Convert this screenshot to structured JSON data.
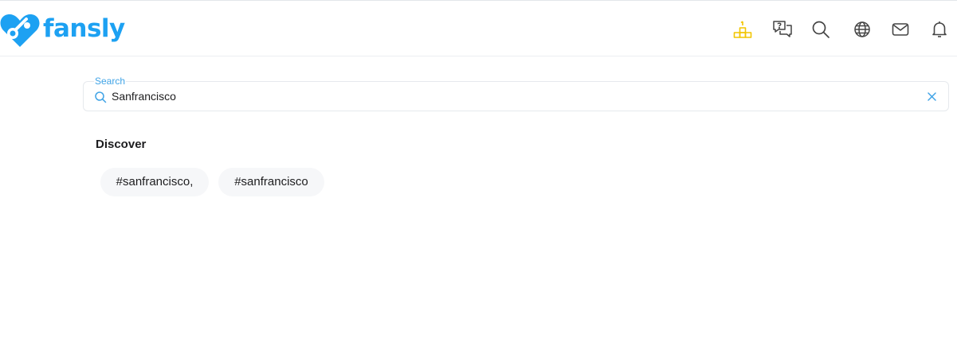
{
  "brand": {
    "name": "fansly",
    "color": "#1da1f2"
  },
  "header": {
    "icons": [
      {
        "name": "leaderboard-podium-icon",
        "color": "#f2c500"
      },
      {
        "name": "help-chat-icon",
        "color": "#444444"
      },
      {
        "name": "search-icon",
        "color": "#444444"
      },
      {
        "name": "globe-icon",
        "color": "#444444"
      },
      {
        "name": "messages-envelope-icon",
        "color": "#444444"
      },
      {
        "name": "notifications-bell-icon",
        "color": "#444444"
      }
    ]
  },
  "search": {
    "label": "Search",
    "value": "Sanfrancisco",
    "accent": "#3fa3e6"
  },
  "discover": {
    "title": "Discover",
    "tags": [
      "#sanfrancisco,",
      "#sanfrancisco"
    ]
  }
}
